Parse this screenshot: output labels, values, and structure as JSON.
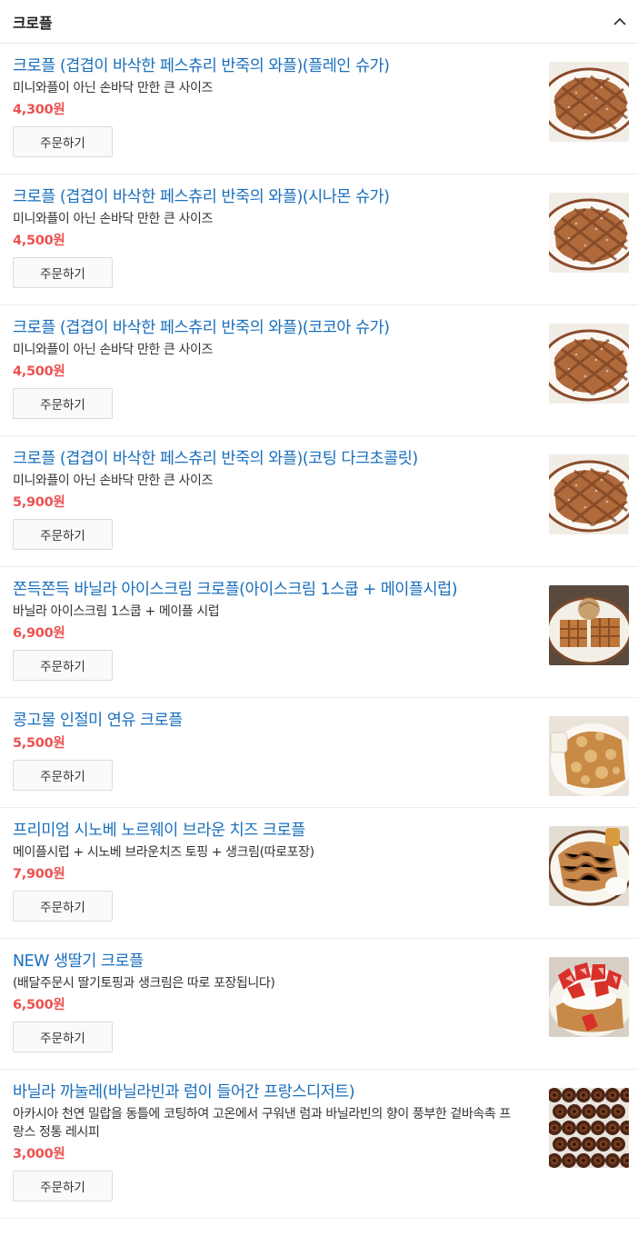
{
  "section": {
    "title": "크로플",
    "collapse_icon": "chevron-up-icon"
  },
  "items": [
    {
      "name": "크로플 (겹겹이 바삭한 페스츄리 반죽의 와플)(플레인 슈가)",
      "desc": "미니와플이 아닌 손바닥 만한 큰 사이즈",
      "price": "4,300원",
      "button": "주문하기",
      "image": "waffle-plate"
    },
    {
      "name": "크로플 (겹겹이 바삭한 페스츄리 반죽의 와플)(시나몬 슈가)",
      "desc": "미니와플이 아닌 손바닥 만한 큰 사이즈",
      "price": "4,500원",
      "button": "주문하기",
      "image": "waffle-plate"
    },
    {
      "name": "크로플 (겹겹이 바삭한 페스츄리 반죽의 와플)(코코아 슈가)",
      "desc": "미니와플이 아닌 손바닥 만한 큰 사이즈",
      "price": "4,500원",
      "button": "주문하기",
      "image": "waffle-plate"
    },
    {
      "name": "크로플 (겹겹이 바삭한 페스츄리 반죽의 와플)(코팅 다크초콜릿)",
      "desc": "미니와플이 아닌 손바닥 만한 큰 사이즈",
      "price": "5,900원",
      "button": "주문하기",
      "image": "waffle-plate"
    },
    {
      "name": "쫀득쫀득 바닐라 아이스크림 크로플(아이스크림 1스쿱 + 메이플시럽)",
      "desc": "바닐라 아이스크림 1스쿱 + 메이플 시럽",
      "price": "6,900원",
      "button": "주문하기",
      "image": "icecream-waffle"
    },
    {
      "name": "콩고물 인절미 연유 크로플",
      "desc": "",
      "price": "5,500원",
      "button": "주문하기",
      "image": "injeolmi-waffle"
    },
    {
      "name": "프리미엄 시노베 노르웨이 브라운 치즈 크로플",
      "desc": "메이플시럽 + 시노베 브라운치즈 토핑 + 생크림(따로포장)",
      "price": "7,900원",
      "button": "주문하기",
      "image": "browncheese-waffle"
    },
    {
      "name": "NEW 생딸기 크로플",
      "desc": "(배달주문시 딸기토핑과 생크림은 따로 포장됩니다)",
      "price": "6,500원",
      "button": "주문하기",
      "image": "strawberry-waffle"
    },
    {
      "name": "바닐라 까눌레(바닐라빈과 럼이 들어간 프랑스디저트)",
      "desc": "아카시아 천연 밀랍을 동틀에 코팅하여 고온에서 구워낸 럼과 바닐라빈의 향이 풍부한 겉바속촉 프랑스 정통 레시피",
      "price": "3,000원",
      "button": "주문하기",
      "image": "canele-tray"
    }
  ]
}
